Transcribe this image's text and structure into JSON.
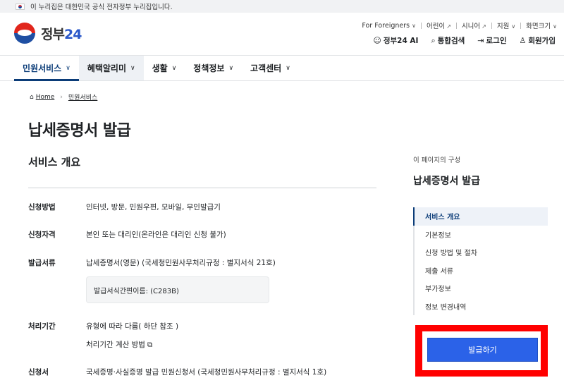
{
  "gov_banner": {
    "text": "이 누리집은 대한민국 공식 전자정부 누리집입니다."
  },
  "logo": {
    "text_ko": "정부",
    "text_num": "24"
  },
  "utility_links": [
    {
      "label": "For Foreigners",
      "icon": "chevron-down-icon"
    },
    {
      "label": "어린이",
      "icon": "external-link-icon"
    },
    {
      "label": "시니어",
      "icon": "external-link-icon"
    },
    {
      "label": "지원",
      "icon": "chevron-down-icon"
    },
    {
      "label": "화면크기",
      "icon": "chevron-down-icon"
    }
  ],
  "header_actions": [
    {
      "label": "정부24 AI",
      "icon": "robot-icon"
    },
    {
      "label": "통합검색",
      "icon": "search-icon"
    },
    {
      "label": "로그인",
      "icon": "login-icon"
    },
    {
      "label": "회원가입",
      "icon": "user-add-icon"
    }
  ],
  "nav": [
    {
      "label": "민원서비스"
    },
    {
      "label": "혜택알리미"
    },
    {
      "label": "생활"
    },
    {
      "label": "정책정보"
    },
    {
      "label": "고객센터"
    }
  ],
  "breadcrumb": {
    "home": "Home",
    "current": "민원서비스"
  },
  "page_title": "납세증명서 발급",
  "section_title": "서비스 개요",
  "rows": {
    "method": {
      "label": "신청방법",
      "value": "인터넷, 방문, 민원우편, 모바일, 무인발급기"
    },
    "eligibility": {
      "label": "신청자격",
      "value": "본인 또는 대리인(온라인은 대리인 신청 불가)"
    },
    "documents": {
      "label": "발급서류",
      "value": "납세증명서(영문) (국세청민원사무처리규정 : 별지서식 21호)",
      "box": "발급서식간편이름: (C283B)"
    },
    "period": {
      "label": "처리기간",
      "value": "유형에 따라 다름( 하단 참조 )",
      "link": "처리기간 계산 방법"
    },
    "form": {
      "label": "신청서",
      "value": "국세증명·사실증명 발급 민원신청서 (국세청민원사무처리규정 : 별지서식 1호)"
    }
  },
  "toc": {
    "label": "이 페이지의 구성",
    "title": "납세증명서 발급",
    "items": [
      "서비스 개요",
      "기본정보",
      "신청 방법 및 절차",
      "제출 서류",
      "부가정보",
      "정보 변경내역"
    ]
  },
  "apply_button": "발급하기",
  "colors": {
    "accent": "#0b3c78",
    "button": "#2b62e8",
    "highlight": "#ff0000"
  }
}
